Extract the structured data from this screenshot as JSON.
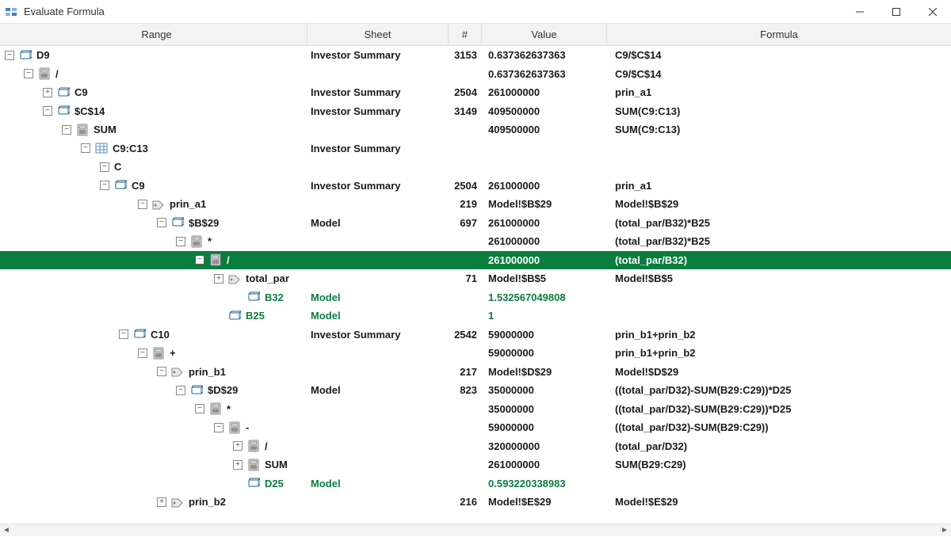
{
  "window": {
    "title": "Evaluate Formula"
  },
  "headers": {
    "range": "Range",
    "sheet": "Sheet",
    "hash": "#",
    "value": "Value",
    "formula": "Formula"
  },
  "rows": [
    {
      "indent": 0,
      "toggle": "-",
      "icon": "cell",
      "label": "D9",
      "sheet": "Investor Summary",
      "hash": "3153",
      "value": "0.637362637363",
      "formula": "C9/$C$14"
    },
    {
      "indent": 1,
      "toggle": "-",
      "icon": "calc",
      "label": "/",
      "sheet": "",
      "hash": "",
      "value": "0.637362637363",
      "formula": "C9/$C$14"
    },
    {
      "indent": 2,
      "toggle": "+",
      "icon": "cell",
      "label": "C9",
      "sheet": "Investor Summary",
      "hash": "2504",
      "value": "261000000",
      "formula": "prin_a1"
    },
    {
      "indent": 2,
      "toggle": "-",
      "icon": "cell",
      "label": "$C$14",
      "sheet": "Investor Summary",
      "hash": "3149",
      "value": "409500000",
      "formula": "SUM(C9:C13)"
    },
    {
      "indent": 3,
      "toggle": "-",
      "icon": "calc",
      "label": "SUM",
      "sheet": "",
      "hash": "",
      "value": "409500000",
      "formula": "SUM(C9:C13)"
    },
    {
      "indent": 4,
      "toggle": "-",
      "icon": "grid",
      "label": "C9:C13",
      "sheet": "Investor Summary",
      "hash": "",
      "value": "",
      "formula": ""
    },
    {
      "indent": 5,
      "toggle": "-",
      "icon": "",
      "label": "C",
      "sheet": "",
      "hash": "",
      "value": "",
      "formula": ""
    },
    {
      "indent": 5,
      "toggle": "-",
      "icon": "cell",
      "label": "C9",
      "sheet": "Investor Summary",
      "hash": "2504",
      "value": "261000000",
      "formula": "prin_a1"
    },
    {
      "indent": 7,
      "toggle": "-",
      "icon": "tag",
      "label": "prin_a1",
      "sheet": "",
      "hash": "219",
      "value": "Model!$B$29",
      "formula": "Model!$B$29"
    },
    {
      "indent": 8,
      "toggle": "-",
      "icon": "cell",
      "label": "$B$29",
      "sheet": "Model",
      "hash": "697",
      "value": "261000000",
      "formula": "(total_par/B32)*B25"
    },
    {
      "indent": 9,
      "toggle": "-",
      "icon": "calc",
      "label": "*",
      "sheet": "",
      "hash": "",
      "value": "261000000",
      "formula": "(total_par/B32)*B25"
    },
    {
      "indent": 10,
      "toggle": "-",
      "icon": "calc",
      "label": "/",
      "sheet": "",
      "hash": "",
      "value": "261000000",
      "formula": "(total_par/B32)",
      "selected": true
    },
    {
      "indent": 11,
      "toggle": "+",
      "icon": "tag",
      "label": "total_par",
      "sheet": "",
      "hash": "71",
      "value": "Model!$B$5",
      "formula": "Model!$B$5"
    },
    {
      "indent": 12,
      "toggle": "",
      "icon": "cell",
      "label": "B32",
      "sheet": "Model",
      "hash": "",
      "value": "1.532567049808",
      "formula": "",
      "green": true
    },
    {
      "indent": 11,
      "toggle": "",
      "icon": "cell",
      "label": "B25",
      "sheet": "Model",
      "hash": "",
      "value": "1",
      "formula": "",
      "green": true
    },
    {
      "indent": 6,
      "toggle": "-",
      "icon": "cell",
      "label": "C10",
      "sheet": "Investor Summary",
      "hash": "2542",
      "value": "59000000",
      "formula": "prin_b1+prin_b2"
    },
    {
      "indent": 7,
      "toggle": "-",
      "icon": "calc",
      "label": "+",
      "sheet": "",
      "hash": "",
      "value": "59000000",
      "formula": "prin_b1+prin_b2"
    },
    {
      "indent": 8,
      "toggle": "-",
      "icon": "tag",
      "label": "prin_b1",
      "sheet": "",
      "hash": "217",
      "value": "Model!$D$29",
      "formula": "Model!$D$29"
    },
    {
      "indent": 9,
      "toggle": "-",
      "icon": "cell",
      "label": "$D$29",
      "sheet": "Model",
      "hash": "823",
      "value": "35000000",
      "formula": "((total_par/D32)-SUM(B29:C29))*D25"
    },
    {
      "indent": 10,
      "toggle": "-",
      "icon": "calc",
      "label": "*",
      "sheet": "",
      "hash": "",
      "value": "35000000",
      "formula": "((total_par/D32)-SUM(B29:C29))*D25"
    },
    {
      "indent": 11,
      "toggle": "-",
      "icon": "calc",
      "label": "-",
      "sheet": "",
      "hash": "",
      "value": "59000000",
      "formula": "((total_par/D32)-SUM(B29:C29))"
    },
    {
      "indent": 12,
      "toggle": "+",
      "icon": "calc",
      "label": "/",
      "sheet": "",
      "hash": "",
      "value": "320000000",
      "formula": "(total_par/D32)"
    },
    {
      "indent": 12,
      "toggle": "+",
      "icon": "calc",
      "label": "SUM",
      "sheet": "",
      "hash": "",
      "value": "261000000",
      "formula": "SUM(B29:C29)"
    },
    {
      "indent": 12,
      "toggle": "",
      "icon": "cell",
      "label": "D25",
      "sheet": "Model",
      "hash": "",
      "value": "0.593220338983",
      "formula": "",
      "green": true
    },
    {
      "indent": 8,
      "toggle": "+",
      "icon": "tag",
      "label": "prin_b2",
      "sheet": "",
      "hash": "216",
      "value": "Model!$E$29",
      "formula": "Model!$E$29"
    }
  ]
}
